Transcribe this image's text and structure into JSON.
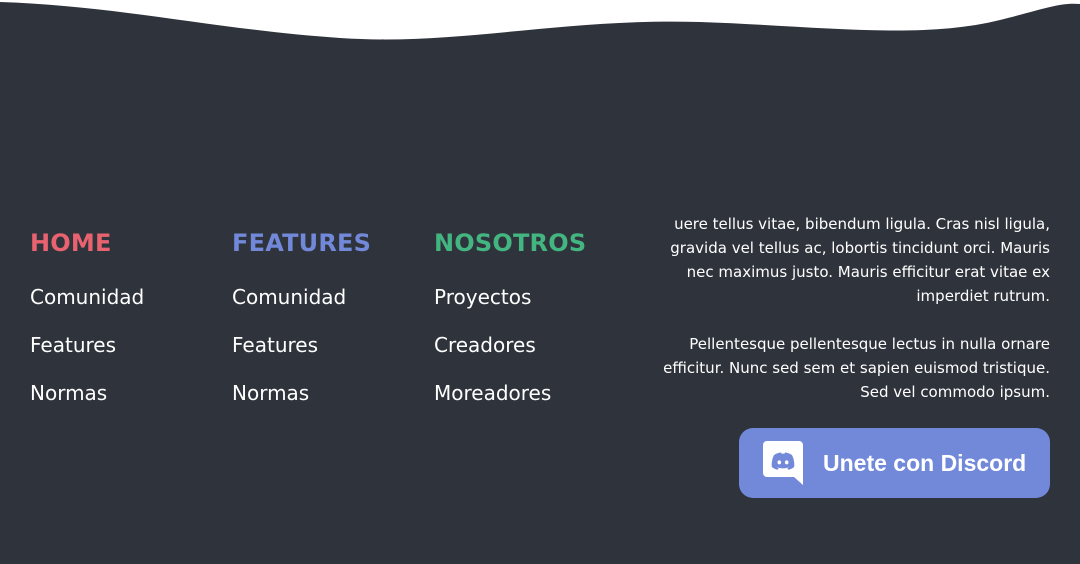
{
  "colors": {
    "background": "#2f333b",
    "wave": "#ffffff",
    "home_accent": "#e8626f",
    "features_accent": "#7289da",
    "nosotros_accent": "#43b581",
    "button_bg": "#7289da",
    "text": "#ffffff"
  },
  "columns": [
    {
      "title": "HOME",
      "links": [
        "Comunidad",
        "Features",
        "Normas"
      ]
    },
    {
      "title": "FEATURES",
      "links": [
        "Comunidad",
        "Features",
        "Normas"
      ]
    },
    {
      "title": "NOSOTROS",
      "links": [
        "Proyectos",
        "Creadores",
        "Moreadores"
      ]
    }
  ],
  "about": {
    "paragraph1": "uere tellus vitae, bibendum ligula. Cras nisl ligula, gravida vel tellus ac, lobortis tincidunt orci. Mauris nec maximus justo. Mauris efficitur erat vitae ex imperdiet rutrum.",
    "paragraph2": "Pellentesque pellentesque lectus in nulla ornare efficitur. Nunc sed sem et sapien euismod tristique. Sed vel commodo ipsum."
  },
  "discord_button": {
    "label": "Unete con Discord",
    "icon": "discord-icon"
  }
}
